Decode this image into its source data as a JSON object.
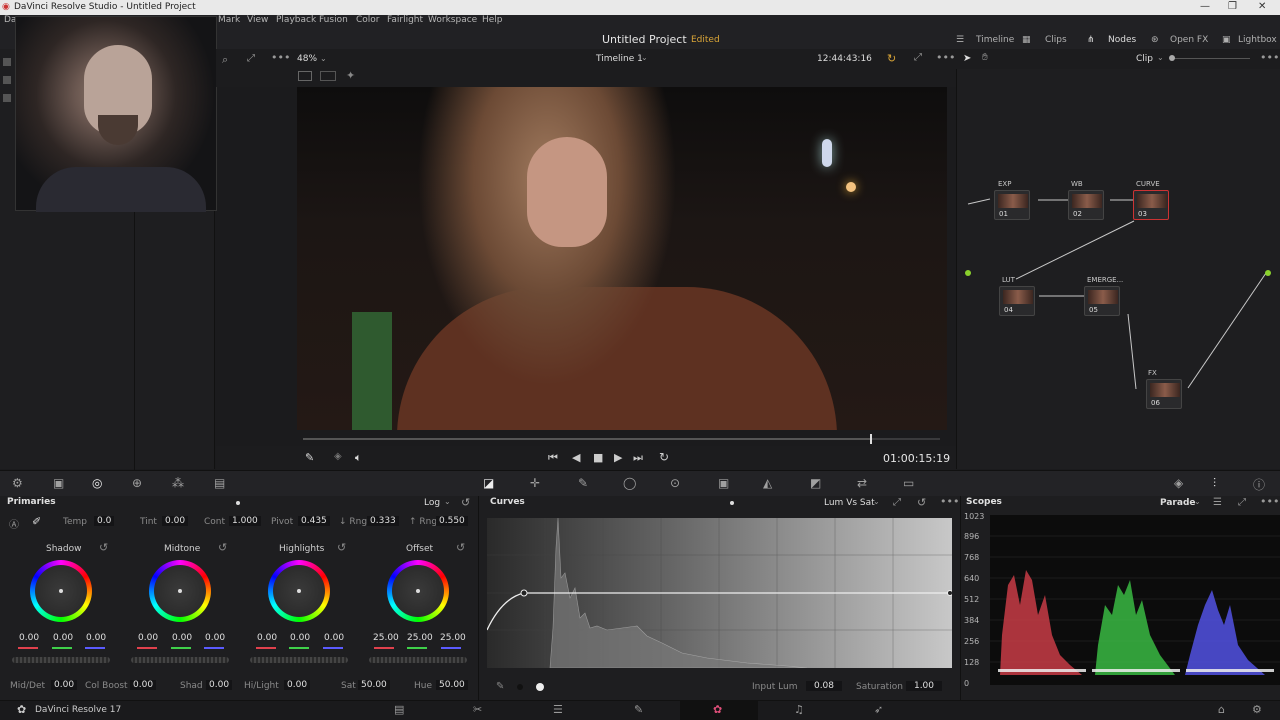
{
  "window": {
    "title": "DaVinci Resolve Studio - Untitled Project",
    "controls": [
      "—",
      "❐",
      "✕"
    ]
  },
  "menu": [
    "Da",
    "Mark",
    "View",
    "Playback",
    "Fusion",
    "Color",
    "Fairlight",
    "Workspace",
    "Help"
  ],
  "project": {
    "title": "Untitled Project",
    "status": "Edited"
  },
  "top_buttons": {
    "timeline": "Timeline",
    "clips": "Clips",
    "nodes": "Nodes",
    "openfx": "Open FX",
    "lightbox": "Lightbox"
  },
  "viewer": {
    "zoom": "48%",
    "timeline_name": "Timeline 1",
    "timecode_top": "12:44:43:16",
    "timecode": "01:00:15:19"
  },
  "nodes": {
    "mode": "Clip",
    "items": [
      {
        "label": "EXP",
        "num": "01"
      },
      {
        "label": "WB",
        "num": "02"
      },
      {
        "label": "CURVE",
        "num": "03"
      },
      {
        "label": "LUT",
        "num": "04"
      },
      {
        "label": "EMERGE...",
        "num": "05"
      },
      {
        "label": "FX",
        "num": "06"
      }
    ]
  },
  "primaries": {
    "title": "Primaries",
    "mode": "Log",
    "temp_label": "Temp",
    "temp": "0.0",
    "tint_label": "Tint",
    "tint": "0.00",
    "cont_label": "Cont",
    "cont": "1.000",
    "pivot_label": "Pivot",
    "pivot": "0.435",
    "lrng_label": "↓ Rng",
    "lrng": "0.333",
    "hrng_label": "↑ Rng",
    "hrng": "0.550",
    "wheels": [
      {
        "name": "Shadow",
        "v": [
          "0.00",
          "0.00",
          "0.00"
        ]
      },
      {
        "name": "Midtone",
        "v": [
          "0.00",
          "0.00",
          "0.00"
        ]
      },
      {
        "name": "Highlights",
        "v": [
          "0.00",
          "0.00",
          "0.00"
        ]
      },
      {
        "name": "Offset",
        "v": [
          "25.00",
          "25.00",
          "25.00"
        ]
      }
    ],
    "middet_label": "Mid/Det",
    "middet": "0.00",
    "colboost_label": "Col Boost",
    "colboost": "0.00",
    "shad_label": "Shad",
    "shad": "0.00",
    "hilight_label": "Hi/Light",
    "hilight": "0.00",
    "sat_label": "Sat",
    "sat": "50.00",
    "hue_label": "Hue",
    "hue": "50.00"
  },
  "curves": {
    "title": "Curves",
    "mode": "Lum Vs Sat",
    "input_lum_label": "Input Lum",
    "input_lum": "0.08",
    "saturation_label": "Saturation",
    "saturation": "1.00"
  },
  "scopes": {
    "title": "Scopes",
    "mode": "Parade",
    "y_ticks": [
      "1023",
      "896",
      "768",
      "640",
      "512",
      "384",
      "256",
      "128",
      "0"
    ]
  },
  "app": {
    "name": "DaVinci Resolve 17"
  },
  "colors": {
    "accent": "#d8a437",
    "red": "#e0414d",
    "green": "#3fd04a",
    "blue": "#5b5bff"
  }
}
